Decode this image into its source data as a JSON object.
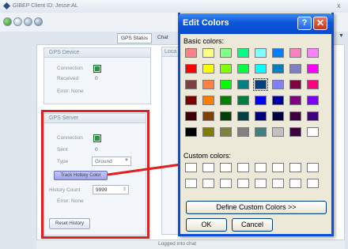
{
  "app": {
    "title": "GIBEP Client ID: Jesse:AL",
    "close_glyph": "x",
    "tabs": [
      "GPS Status",
      "Chat"
    ],
    "side_tab_text": "Loca",
    "status": "Logged into chat"
  },
  "gps_device": {
    "title": "GPS Device",
    "connection_label": "Connection",
    "received_label": "Received",
    "received_value": "0",
    "error_label": "Error: None"
  },
  "gps_server": {
    "title": "GPS Server",
    "connection_label": "Connection",
    "sent_label": "Sent",
    "sent_value": "0",
    "type_label": "Type",
    "type_value": "Ground",
    "track_button": "Track Hotkey Color",
    "history_label": "History Count",
    "history_value": "9999",
    "error_label": "Error: None",
    "reset_button": "Reset History"
  },
  "dialog": {
    "title": "Edit Colors",
    "help_glyph": "?",
    "close_glyph": "✕",
    "basic_label": "Basic colors:",
    "custom_label": "Custom colors:",
    "define_button": "Define Custom Colors >>",
    "ok_button": "OK",
    "cancel_button": "Cancel",
    "basic_colors": [
      "#ff8080",
      "#ffff80",
      "#80ff80",
      "#00ff80",
      "#80ffff",
      "#0080ff",
      "#ff80c0",
      "#ff80ff",
      "#ff0000",
      "#ffff00",
      "#80ff00",
      "#00ff40",
      "#00ffff",
      "#0080c0",
      "#8080c0",
      "#ff00ff",
      "#804040",
      "#ff8040",
      "#00ff00",
      "#008080",
      "#004080",
      "#8080ff",
      "#800040",
      "#ff0080",
      "#800000",
      "#ff8000",
      "#008000",
      "#008040",
      "#0000ff",
      "#0000a0",
      "#800080",
      "#8000ff",
      "#400000",
      "#804000",
      "#004000",
      "#004040",
      "#000080",
      "#000040",
      "#400040",
      "#400080",
      "#000000",
      "#808000",
      "#808040",
      "#808080",
      "#408080",
      "#c0c0c0",
      "#400040",
      "#ffffff"
    ],
    "selected_index": 20,
    "custom_colors": [
      "#ffffff",
      "#ffffff",
      "#ffffff",
      "#ffffff",
      "#ffffff",
      "#ffffff",
      "#ffffff",
      "#ffffff",
      "#ffffff",
      "#ffffff",
      "#ffffff",
      "#ffffff",
      "#ffffff",
      "#ffffff",
      "#ffffff",
      "#ffffff"
    ]
  },
  "annotation": {
    "box_color": "#e02020",
    "arrow_color": "#e02020"
  }
}
